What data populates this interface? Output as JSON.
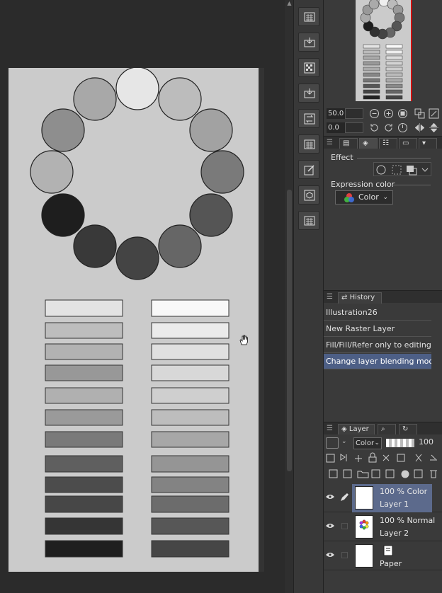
{
  "navigator": {
    "zoom": "50.0",
    "rotation": "0.0"
  },
  "properties": {
    "effect_label": "Effect",
    "expression_color_label": "Expression color",
    "expression_color_value": "Color"
  },
  "history": {
    "tab_label": "History",
    "items": [
      "Illustration26",
      "New Raster Layer",
      "Fill/Fill/Refer only to editing layer",
      "Change layer blending mode"
    ]
  },
  "layers": {
    "tab_label": "Layer",
    "blend_mode": "Color",
    "opacity": "100",
    "rows": [
      {
        "info": "100 % Color",
        "name": "Layer 1"
      },
      {
        "info": "100 % Normal",
        "name": "Layer 2"
      },
      {
        "info": "",
        "name": "Paper"
      }
    ]
  },
  "colors": {
    "accent": "#5c6a8c",
    "history_selected": "#4d5f86",
    "canvas_bg": "#2b2b2b",
    "panel_bg": "#3a3a3a",
    "paper": "#cbcbcb"
  },
  "icons": [
    "command-icon",
    "zoom-out-icon",
    "zoom-in-icon",
    "fit-icon",
    "rotate-left-icon",
    "rotate-right-icon",
    "flip-icon",
    "eye-icon",
    "pen-icon",
    "hand-cursor-icon"
  ]
}
